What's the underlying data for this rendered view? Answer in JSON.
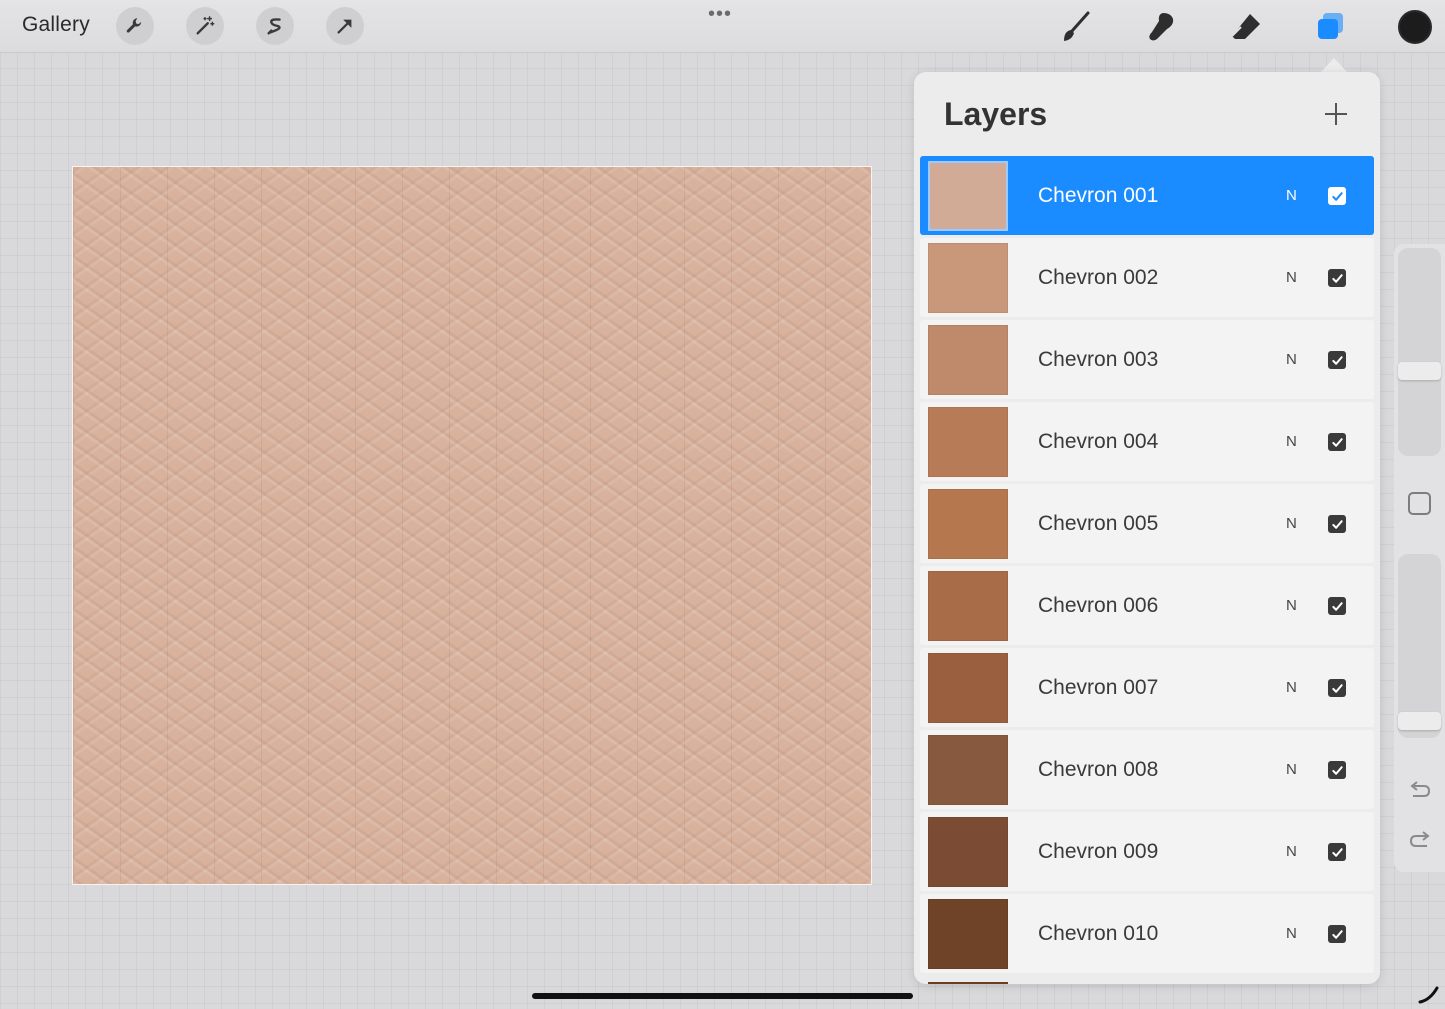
{
  "topbar": {
    "gallery_label": "Gallery",
    "left_tools": [
      "wrench-icon",
      "magic-wand-icon",
      "selection-icon",
      "transform-arrow-icon"
    ],
    "right_tools": [
      "brush-icon",
      "smudge-icon",
      "eraser-icon",
      "layers-icon"
    ],
    "active_tool": "layers-icon",
    "current_color": "#1c1c1c",
    "accent_color": "#1a8cff"
  },
  "layers_panel": {
    "title": "Layers",
    "layers": [
      {
        "name": "Chevron 001",
        "blend": "N",
        "visible": true,
        "selected": true,
        "color": "#d2ab96"
      },
      {
        "name": "Chevron 002",
        "blend": "N",
        "visible": true,
        "selected": false,
        "color": "#c9987a"
      },
      {
        "name": "Chevron 003",
        "blend": "N",
        "visible": true,
        "selected": false,
        "color": "#bf8a6c"
      },
      {
        "name": "Chevron 004",
        "blend": "N",
        "visible": true,
        "selected": false,
        "color": "#b87b58"
      },
      {
        "name": "Chevron 005",
        "blend": "N",
        "visible": true,
        "selected": false,
        "color": "#b5774e"
      },
      {
        "name": "Chevron 006",
        "blend": "N",
        "visible": true,
        "selected": false,
        "color": "#a96c48"
      },
      {
        "name": "Chevron 007",
        "blend": "N",
        "visible": true,
        "selected": false,
        "color": "#9a5f3e"
      },
      {
        "name": "Chevron 008",
        "blend": "N",
        "visible": true,
        "selected": false,
        "color": "#87593e"
      },
      {
        "name": "Chevron 009",
        "blend": "N",
        "visible": true,
        "selected": false,
        "color": "#7b4c33"
      },
      {
        "name": "Chevron 010",
        "blend": "N",
        "visible": true,
        "selected": false,
        "color": "#6e4328"
      }
    ]
  },
  "sidebar": {
    "brush_size_level": 0.6,
    "opacity_level": 0.95
  }
}
